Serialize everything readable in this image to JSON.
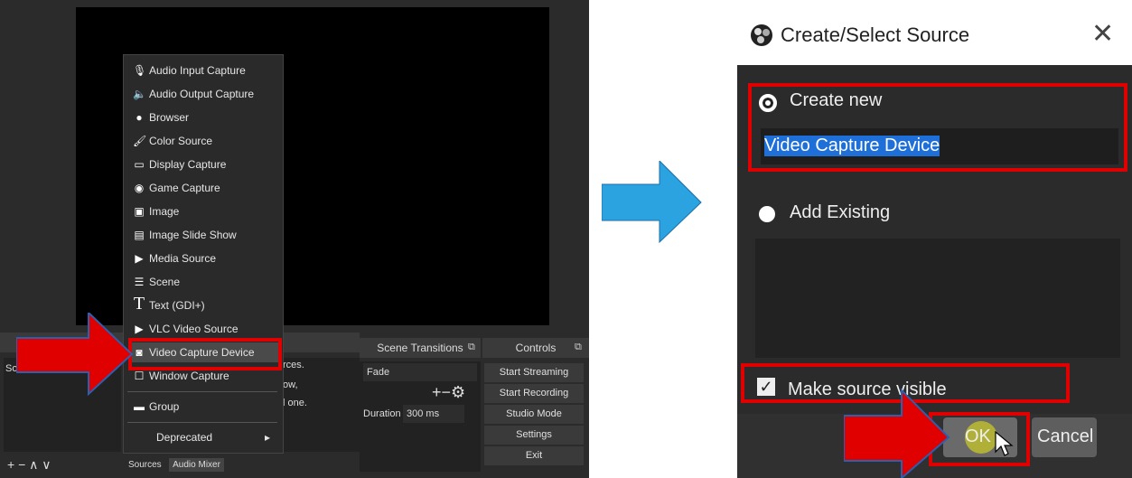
{
  "menu": {
    "items": [
      {
        "label": "Audio Input Capture",
        "icon": "microphone-icon",
        "glyph": "🎙"
      },
      {
        "label": "Audio Output Capture",
        "icon": "speaker-icon",
        "glyph": "🔈"
      },
      {
        "label": "Browser",
        "icon": "globe-icon",
        "glyph": "●"
      },
      {
        "label": "Color Source",
        "icon": "brush-icon",
        "glyph": "🖌"
      },
      {
        "label": "Display Capture",
        "icon": "monitor-icon",
        "glyph": "▭"
      },
      {
        "label": "Game Capture",
        "icon": "gamepad-icon",
        "glyph": "◉"
      },
      {
        "label": "Image",
        "icon": "image-icon",
        "glyph": "▣"
      },
      {
        "label": "Image Slide Show",
        "icon": "slideshow-icon",
        "glyph": "▤"
      },
      {
        "label": "Media Source",
        "icon": "play-icon",
        "glyph": "▶"
      },
      {
        "label": "Scene",
        "icon": "list-icon",
        "glyph": "☰"
      },
      {
        "label": "Text (GDI+)",
        "icon": "text-icon",
        "glyph": "T"
      },
      {
        "label": "VLC Video Source",
        "icon": "play-icon",
        "glyph": "▶"
      },
      {
        "label": "Video Capture Device",
        "icon": "camera-icon",
        "glyph": "◙"
      },
      {
        "label": "Window Capture",
        "icon": "window-icon",
        "glyph": "☐"
      },
      {
        "label": "Group",
        "icon": "folder-icon",
        "glyph": "▬"
      },
      {
        "label": "Deprecated",
        "icon": "",
        "glyph": ""
      }
    ],
    "submenu_arrow": "▸"
  },
  "obs": {
    "scene_transitions_title": "Scene Transitions",
    "controls_title": "Controls",
    "transition_value": "Fade",
    "duration_label": "Duration",
    "duration_value": "300 ms",
    "plus_gear": "+−⚙",
    "controls": [
      "Start Streaming",
      "Start Recording",
      "Studio Mode",
      "Settings",
      "Exit"
    ],
    "sources_fragments": [
      "rces.",
      "ow,",
      "l one."
    ],
    "tabs": {
      "sources": "Sources",
      "audio_mixer": "Audio Mixer"
    },
    "scenes_fragment": "So",
    "bottom_left": "+ −  ∧ ∨",
    "plus_small": "+"
  },
  "dialog": {
    "title": "Create/Select Source",
    "close": "✕",
    "create_new": "Create new",
    "name_value": "Video Capture Device",
    "add_existing": "Add Existing",
    "make_visible": "Make source visible",
    "ok": "OK",
    "cancel": "Cancel"
  },
  "colors": {
    "highlight": "#e00000",
    "arrow_blue": "#2aa3e0",
    "selection": "#1f6fd8"
  }
}
